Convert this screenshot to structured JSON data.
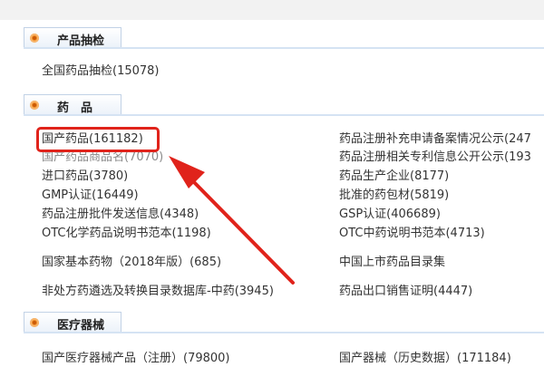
{
  "sections": [
    {
      "title": "产品抽检",
      "items": [
        {
          "label": "全国药品抽检(15078)"
        }
      ]
    },
    {
      "title": "药　品",
      "left_items": [
        {
          "label": "国产药品(161182)"
        },
        {
          "label": "国产药品商品名(7070)"
        },
        {
          "label": "进口药品(3780)"
        },
        {
          "label": "GMP认证(16449)"
        },
        {
          "label": "药品注册批件发送信息(4348)"
        },
        {
          "label": "OTC化学药品说明书范本(1198)"
        },
        {
          "label": "国家基本药物（2018年版）(685)"
        },
        {
          "label": "非处方药遴选及转换目录数据库-中药(3945)"
        }
      ],
      "right_items": [
        {
          "label": "药品注册补充申请备案情况公示(247"
        },
        {
          "label": "药品注册相关专利信息公开公示(193"
        },
        {
          "label": "药品生产企业(8177)"
        },
        {
          "label": "批准的药包材(5819)"
        },
        {
          "label": "GSP认证(406689)"
        },
        {
          "label": "OTC中药说明书范本(4713)"
        },
        {
          "label": "中国上市药品目录集"
        },
        {
          "label": "药品出口销售证明(4447)"
        }
      ]
    },
    {
      "title": "医疗器械",
      "left_items": [
        {
          "label": "国产医疗器械产品（注册）(79800)"
        }
      ],
      "right_items": [
        {
          "label": "国产器械（历史数据）(171184)"
        }
      ]
    }
  ],
  "colors": {
    "highlight": "#e0231b",
    "section_icon": "#f08b22",
    "text": "#333333"
  },
  "icons": {
    "section": "orange-dot-icon",
    "annotation": "red-arrow-icon"
  }
}
